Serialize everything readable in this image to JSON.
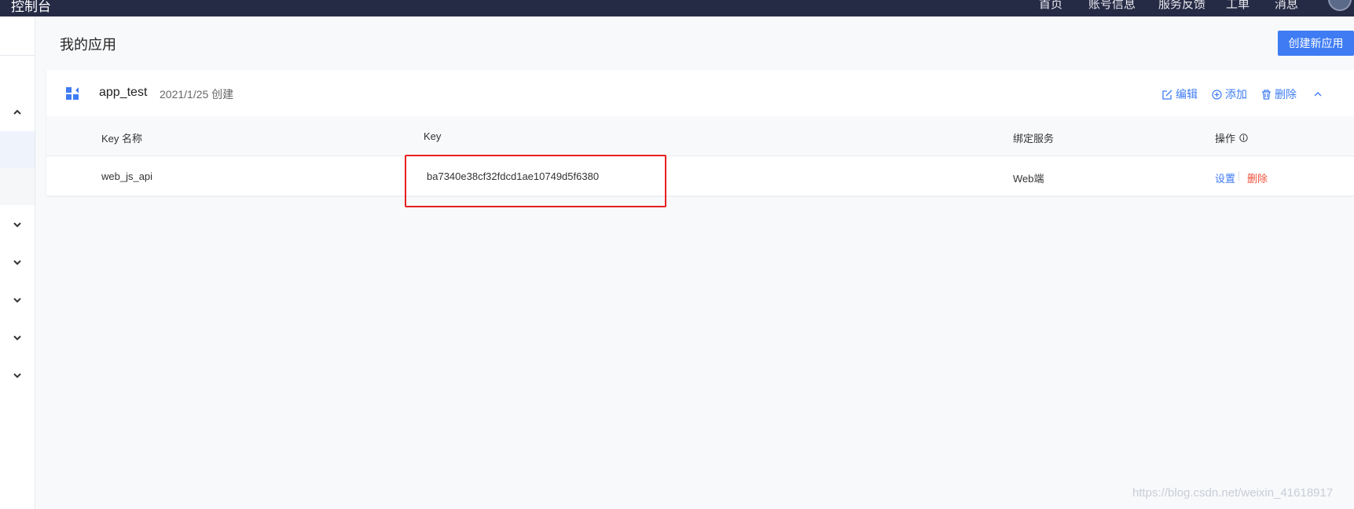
{
  "topbar": {
    "brand": "控制台",
    "nav": [
      "首页",
      "账号信息",
      "服务反馈",
      "工单",
      "消息"
    ]
  },
  "sidebar": {
    "chevrons": [
      "chevron-up-icon",
      "chevron-down-icon",
      "chevron-down-icon",
      "chevron-down-icon",
      "chevron-down-icon",
      "chevron-down-icon"
    ]
  },
  "header": {
    "title": "我的应用",
    "create_button": "创建新应用"
  },
  "app": {
    "name": "app_test",
    "created": "2021/1/25 创建",
    "actions": {
      "edit": "编辑",
      "add": "添加",
      "delete": "删除"
    }
  },
  "table": {
    "columns": [
      "Key 名称",
      "Key",
      "绑定服务",
      "操作"
    ],
    "rows": [
      {
        "key_name": "web_js_api",
        "key": "ba7340e38cf32fdcd1ae10749d5f6380",
        "service": "Web端",
        "op_settings": "设置",
        "op_delete": "删除"
      }
    ]
  },
  "colors": {
    "accent": "#3f7cf4",
    "topbar": "#262b45",
    "danger": "#f0503c",
    "highlight": "#e8201f"
  },
  "watermark": "https://blog.csdn.net/weixin_41618917"
}
